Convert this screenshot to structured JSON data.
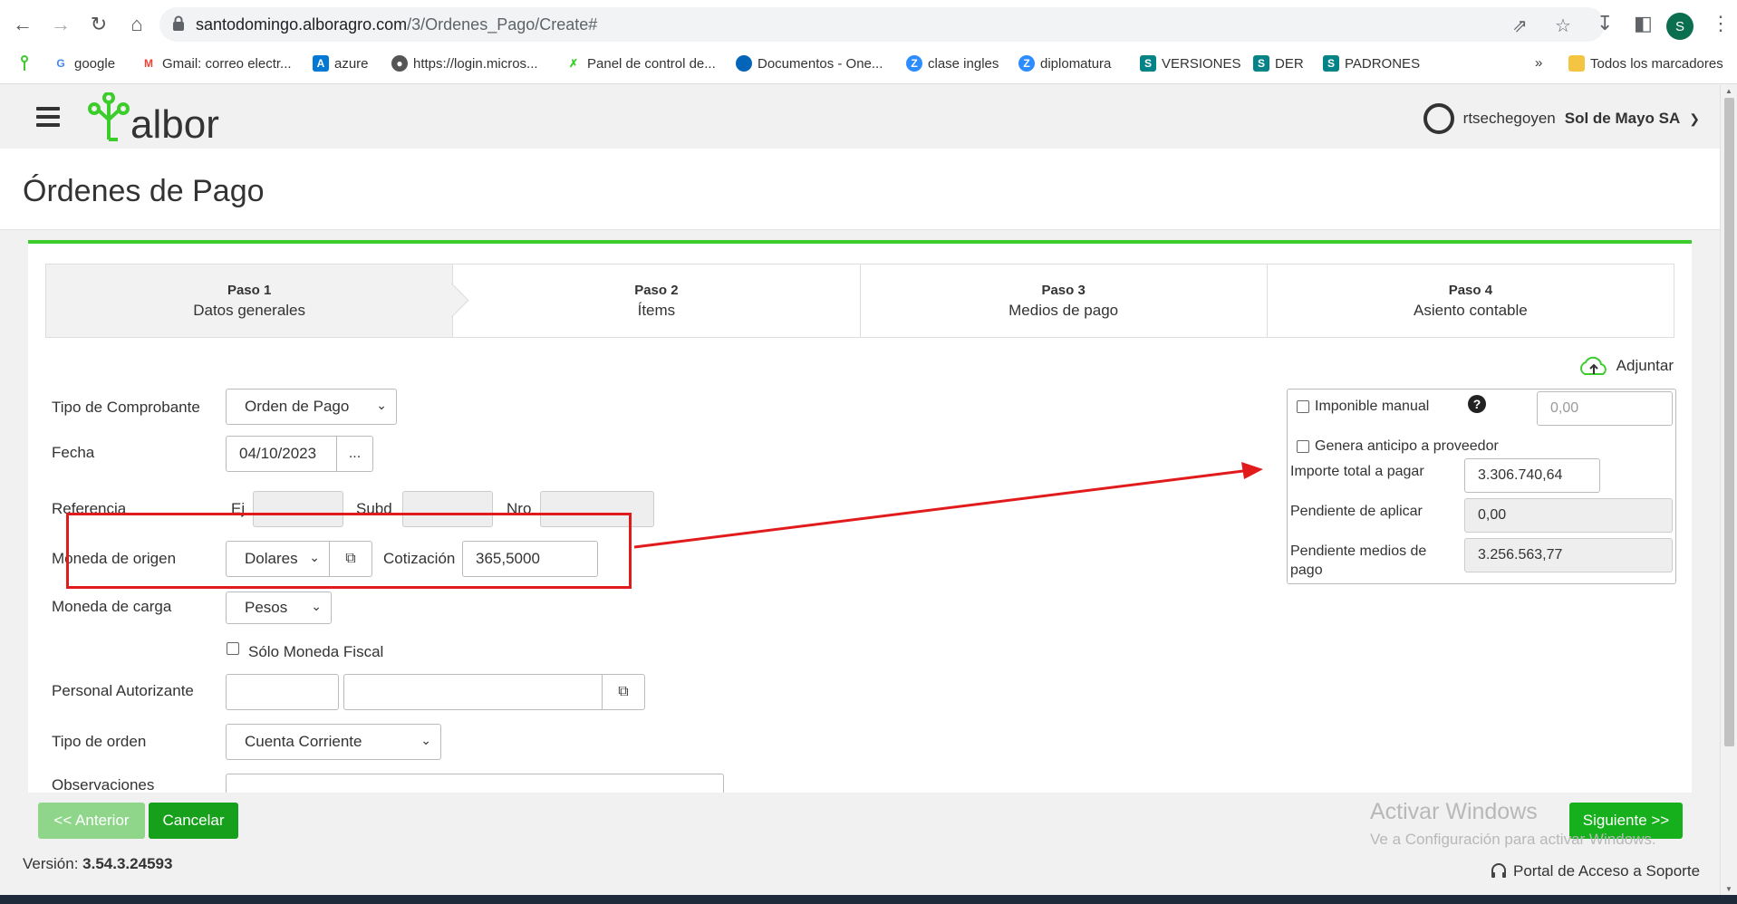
{
  "browser": {
    "url_host": "santodomingo.alboragro.com",
    "url_path": "/3/Ordenes_Pago/Create#",
    "profile_initial": "S",
    "bookmarks": [
      {
        "label": "google",
        "icon": "google-icon",
        "color": "#4285f4"
      },
      {
        "label": "Gmail: correo electr...",
        "icon": "gmail-icon",
        "color": "#ea4335"
      },
      {
        "label": "azure",
        "icon": "azure-icon",
        "color": "#0078d4"
      },
      {
        "label": "https://login.micros...",
        "icon": "globe-icon",
        "color": "#555555"
      },
      {
        "label": "Panel de control de...",
        "icon": "panel-icon",
        "color": "#3ccd2d"
      },
      {
        "label": "Documentos - One...",
        "icon": "onedrive-icon",
        "color": "#0364b8"
      },
      {
        "label": "clase ingles",
        "icon": "zoom-icon",
        "color": "#2d8cff"
      },
      {
        "label": "diplomatura",
        "icon": "zoom-icon",
        "color": "#2d8cff"
      },
      {
        "label": "VERSIONES",
        "icon": "sharepoint-icon",
        "color": "#038387"
      },
      {
        "label": "DER",
        "icon": "sharepoint-icon",
        "color": "#038387"
      },
      {
        "label": "PADRONES",
        "icon": "sharepoint-icon",
        "color": "#038387"
      }
    ],
    "more_bookmarks": "»",
    "all_bookmarks": "Todos los marcadores"
  },
  "header": {
    "logo_text": "albor",
    "username": "rtsechegoyen",
    "company": "Sol de Mayo SA"
  },
  "page": {
    "title": "Órdenes de Pago"
  },
  "steps": [
    {
      "num": "Paso 1",
      "label": "Datos generales"
    },
    {
      "num": "Paso 2",
      "label": "Ítems"
    },
    {
      "num": "Paso 3",
      "label": "Medios de pago"
    },
    {
      "num": "Paso 4",
      "label": "Asiento contable"
    }
  ],
  "attach_label": "Adjuntar",
  "form": {
    "tipo_comprobante": {
      "label": "Tipo de Comprobante",
      "value": "Orden de Pago"
    },
    "fecha": {
      "label": "Fecha",
      "value": "04/10/2023",
      "picker": "..."
    },
    "referencia": {
      "label": "Referencia",
      "ej": "Ej",
      "subd": "Subd",
      "nro": "Nro"
    },
    "moneda_origen": {
      "label": "Moneda de origen",
      "value": "Dolares"
    },
    "cotizacion": {
      "label": "Cotización",
      "value": "365,5000"
    },
    "moneda_carga": {
      "label": "Moneda de carga",
      "value": "Pesos"
    },
    "solo_fiscal": {
      "label": "Sólo Moneda Fiscal"
    },
    "personal": {
      "label": "Personal Autorizante"
    },
    "tipo_orden": {
      "label": "Tipo de orden",
      "value": "Cuenta Corriente"
    },
    "observaciones": {
      "label": "Observaciones"
    }
  },
  "summary": {
    "imponible_label": "Imponible manual",
    "imponible_placeholder": "0,00",
    "anticipo_label": "Genera anticipo a proveedor",
    "total_label": "Importe total a pagar",
    "total_value": "3.306.740,64",
    "pendiente_aplicar_label": "Pendiente de aplicar",
    "pendiente_aplicar_value": "0,00",
    "pendiente_medios_label_1": "Pendiente medios de",
    "pendiente_medios_label_2": "pago",
    "pendiente_medios_value": "3.256.563,77"
  },
  "buttons": {
    "prev": "<< Anterior",
    "cancel": "Cancelar",
    "next": "Siguiente >>"
  },
  "watermark": {
    "line1": "Activar Windows",
    "line2": "Ve a Configuración para activar Windows."
  },
  "footer": {
    "version_label": "Versión:",
    "version_value": "3.54.3.24593",
    "support": "Portal de Acceso a Soporte"
  },
  "colors": {
    "accent": "#3ccd2d",
    "button_green": "#16a01b",
    "annotation_red": "#e11b1b"
  }
}
